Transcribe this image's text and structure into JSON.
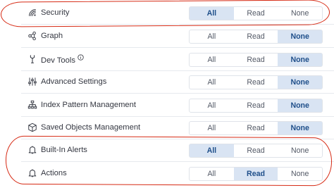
{
  "annotation_color": "#d62a14",
  "features": [
    {
      "name": "Security",
      "icon": "security-icon",
      "options": [
        "All",
        "Read",
        "None"
      ],
      "selected": "All",
      "info": false
    },
    {
      "name": "Graph",
      "icon": "graph-icon",
      "options": [
        "All",
        "Read",
        "None"
      ],
      "selected": "None",
      "info": false
    },
    {
      "name": "Dev Tools",
      "icon": "dev-tools-icon",
      "options": [
        "All",
        "Read",
        "None"
      ],
      "selected": "None",
      "info": true
    },
    {
      "name": "Advanced Settings",
      "icon": "advanced-settings-icon",
      "options": [
        "All",
        "Read",
        "None"
      ],
      "selected": "None",
      "info": false
    },
    {
      "name": "Index Pattern Management",
      "icon": "index-pattern-icon",
      "options": [
        "All",
        "Read",
        "None"
      ],
      "selected": "None",
      "info": false
    },
    {
      "name": "Saved Objects Management",
      "icon": "saved-objects-icon",
      "options": [
        "All",
        "Read",
        "None"
      ],
      "selected": "None",
      "info": false
    },
    {
      "name": "Built-In Alerts",
      "icon": "bell-icon",
      "options": [
        "All",
        "Read",
        "None"
      ],
      "selected": "All",
      "info": false
    },
    {
      "name": "Actions",
      "icon": "bell-icon",
      "options": [
        "All",
        "Read",
        "None"
      ],
      "selected": "Read",
      "info": false
    }
  ]
}
